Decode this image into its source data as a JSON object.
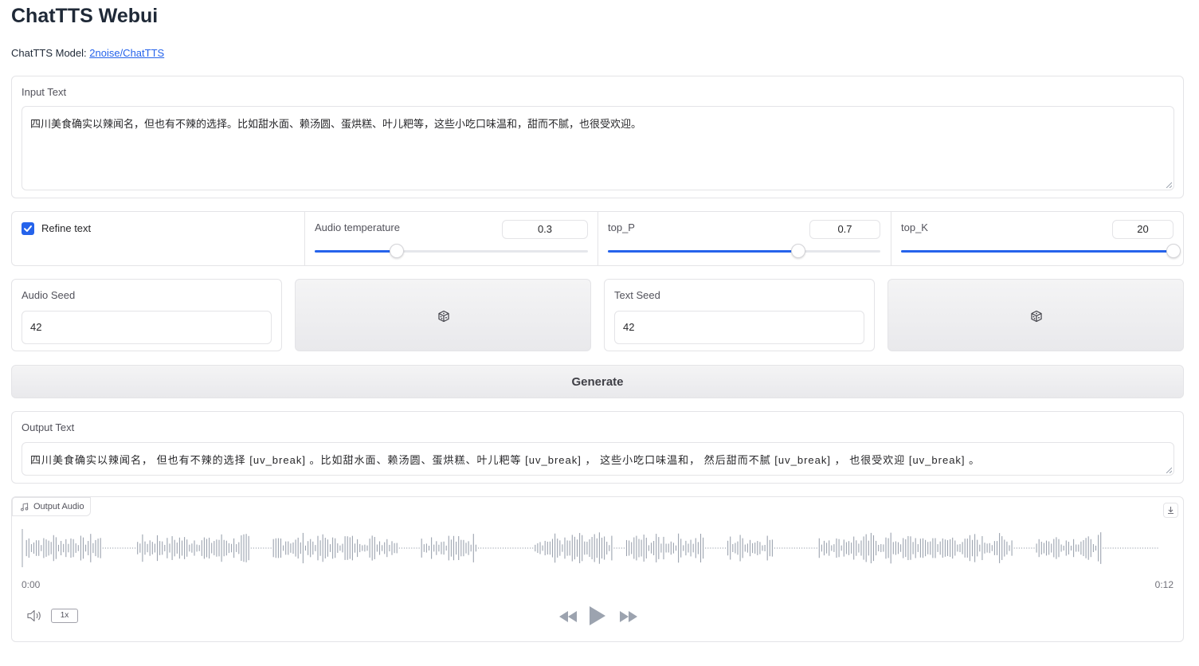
{
  "app": {
    "title": "ChatTTS Webui",
    "model_label": "ChatTTS Model: ",
    "model_link": "2noise/ChatTTS"
  },
  "input": {
    "label": "Input Text",
    "value": "四川美食确实以辣闻名，但也有不辣的选择。比如甜水面、赖汤圆、蛋烘糕、叶儿粑等，这些小吃口味温和，甜而不腻，也很受欢迎。"
  },
  "controls": {
    "refine_label": "Refine text",
    "refine_checked": true,
    "audio_temperature": {
      "label": "Audio temperature",
      "value": "0.3",
      "fraction": 0.3
    },
    "top_p": {
      "label": "top_P",
      "value": "0.7",
      "fraction": 0.7
    },
    "top_k": {
      "label": "top_K",
      "value": "20",
      "fraction": 1.0
    }
  },
  "seeds": {
    "audio_seed_label": "Audio Seed",
    "audio_seed_value": "42",
    "text_seed_label": "Text Seed",
    "text_seed_value": "42",
    "dice_icon": "dice-icon"
  },
  "generate_label": "Generate",
  "output_text": {
    "label": "Output Text",
    "value": "四川美食确实以辣闻名， 但也有不辣的选择 [uv_break] 。比如甜水面、赖汤圆、蛋烘糕、叶儿粑等 [uv_break] ， 这些小吃口味温和， 然后甜而不腻 [uv_break] ， 也很受欢迎 [uv_break] 。"
  },
  "output_audio": {
    "label": "Output Audio",
    "time_start": "0:00",
    "time_end": "0:12",
    "speed": "1x",
    "icons": [
      "music-icon",
      "download-icon",
      "volume-icon",
      "rewind-icon",
      "play-icon",
      "fast-forward-icon"
    ]
  },
  "colors": {
    "accent": "#2563eb",
    "waveform": "#9ca3af"
  }
}
